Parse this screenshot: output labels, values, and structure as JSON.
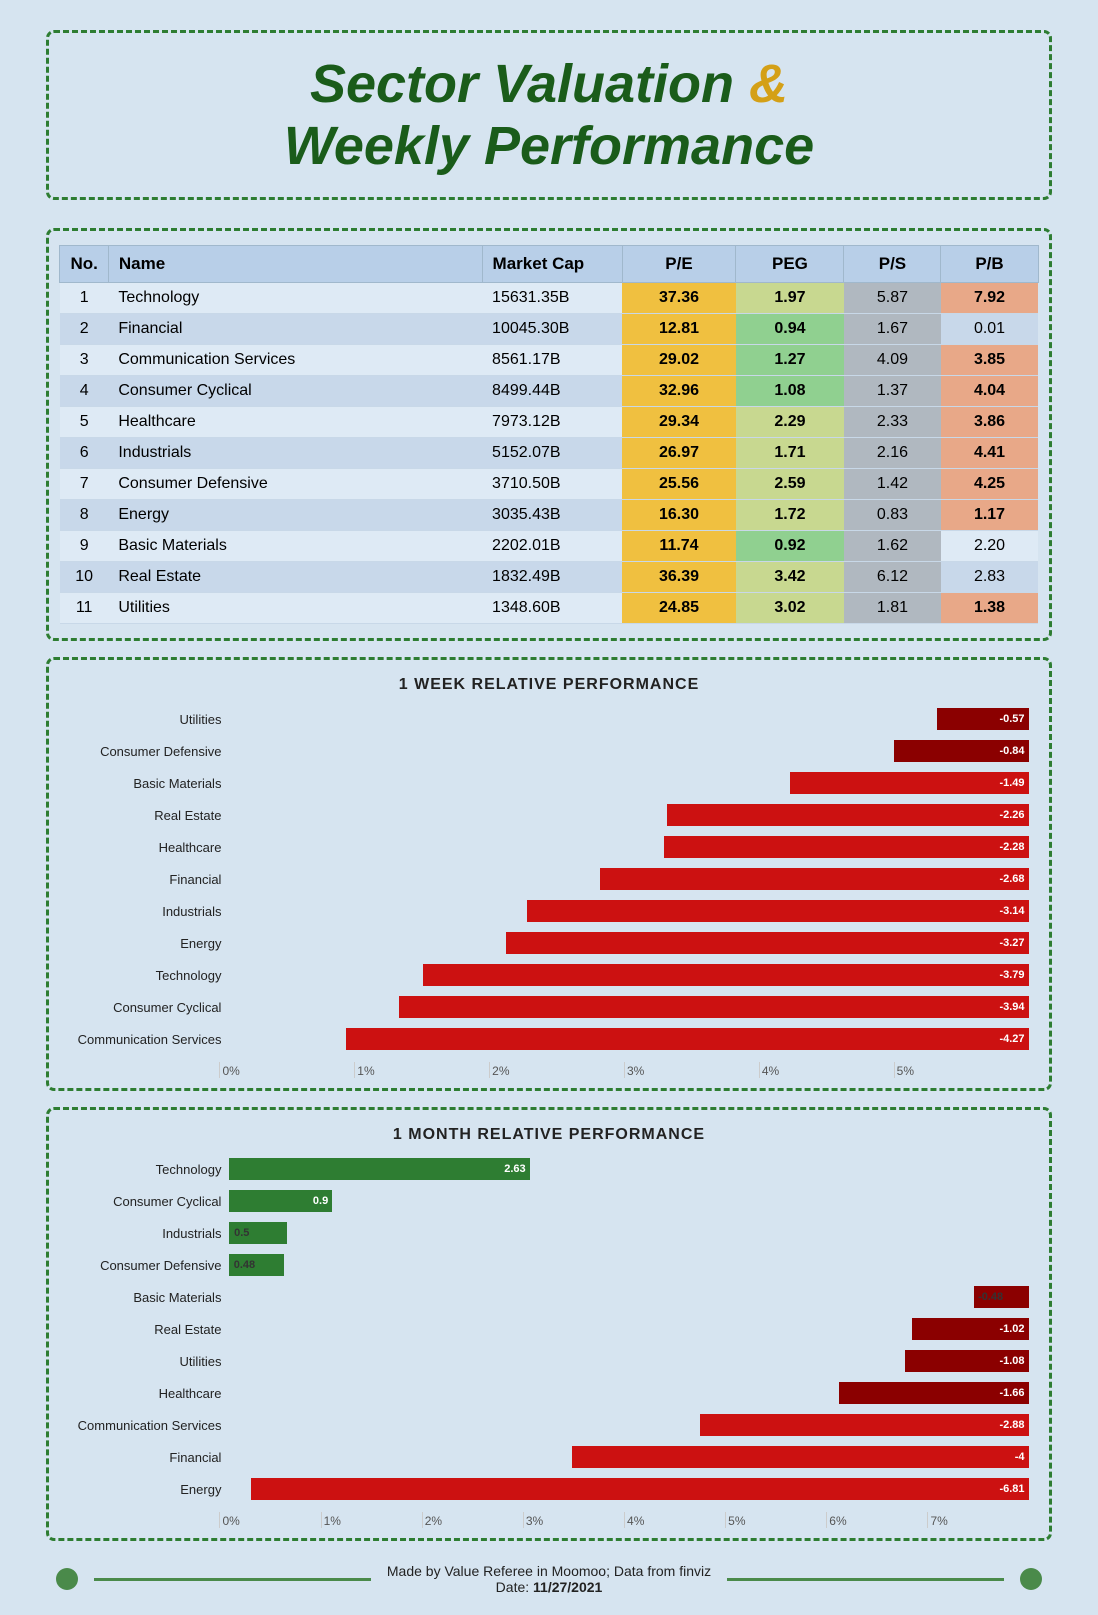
{
  "title": {
    "line1": "Sector Valuation",
    "amp": "&",
    "line2": "Weekly Performance"
  },
  "table": {
    "headers": [
      "No.",
      "Name",
      "Market Cap",
      "P/E",
      "PEG",
      "P/S",
      "P/B"
    ],
    "rows": [
      {
        "no": 1,
        "name": "Technology",
        "mcap": "15631.35B",
        "pe": "37.36",
        "peg": "1.97",
        "ps": "5.87",
        "pb": "7.92",
        "pe_color": "yellow",
        "peg_color": "yellow-green",
        "pb_color": "salmon"
      },
      {
        "no": 2,
        "name": "Financial",
        "mcap": "10045.30B",
        "pe": "12.81",
        "peg": "0.94",
        "ps": "1.67",
        "pb": "0.01",
        "pe_color": "yellow",
        "peg_color": "green",
        "pb_color": "none"
      },
      {
        "no": 3,
        "name": "Communication Services",
        "mcap": "8561.17B",
        "pe": "29.02",
        "peg": "1.27",
        "ps": "4.09",
        "pb": "3.85",
        "pe_color": "yellow",
        "peg_color": "green",
        "pb_color": "salmon"
      },
      {
        "no": 4,
        "name": "Consumer Cyclical",
        "mcap": "8499.44B",
        "pe": "32.96",
        "peg": "1.08",
        "ps": "1.37",
        "pb": "4.04",
        "pe_color": "yellow",
        "peg_color": "green",
        "pb_color": "salmon"
      },
      {
        "no": 5,
        "name": "Healthcare",
        "mcap": "7973.12B",
        "pe": "29.34",
        "peg": "2.29",
        "ps": "2.33",
        "pb": "3.86",
        "pe_color": "yellow",
        "peg_color": "yellow-green",
        "pb_color": "salmon"
      },
      {
        "no": 6,
        "name": "Industrials",
        "mcap": "5152.07B",
        "pe": "26.97",
        "peg": "1.71",
        "ps": "2.16",
        "pb": "4.41",
        "pe_color": "yellow",
        "peg_color": "yellow-green",
        "pb_color": "salmon"
      },
      {
        "no": 7,
        "name": "Consumer Defensive",
        "mcap": "3710.50B",
        "pe": "25.56",
        "peg": "2.59",
        "ps": "1.42",
        "pb": "4.25",
        "pe_color": "yellow",
        "peg_color": "yellow-green",
        "pb_color": "salmon"
      },
      {
        "no": 8,
        "name": "Energy",
        "mcap": "3035.43B",
        "pe": "16.30",
        "peg": "1.72",
        "ps": "0.83",
        "pb": "1.17",
        "pe_color": "yellow",
        "peg_color": "yellow-green",
        "pb_color": "light-salmon"
      },
      {
        "no": 9,
        "name": "Basic Materials",
        "mcap": "2202.01B",
        "pe": "11.74",
        "peg": "0.92",
        "ps": "1.62",
        "pb": "2.20",
        "pe_color": "yellow",
        "peg_color": "green",
        "pb_color": "none"
      },
      {
        "no": 10,
        "name": "Real Estate",
        "mcap": "1832.49B",
        "pe": "36.39",
        "peg": "3.42",
        "ps": "6.12",
        "pb": "2.83",
        "pe_color": "yellow",
        "peg_color": "yellow-green",
        "pb_color": "none"
      },
      {
        "no": 11,
        "name": "Utilities",
        "mcap": "1348.60B",
        "pe": "24.85",
        "peg": "3.02",
        "ps": "1.81",
        "pb": "1.38",
        "pe_color": "yellow",
        "peg_color": "yellow-green",
        "pb_color": "light-salmon"
      }
    ]
  },
  "chart1": {
    "title": "1 WEEK RELATIVE PERFORMANCE",
    "max_pct": 5,
    "ticks": [
      "0%",
      "1%",
      "2%",
      "3%",
      "4%",
      "5%"
    ],
    "bars": [
      {
        "label": "Utilities",
        "value": -0.57,
        "color": "dark-red"
      },
      {
        "label": "Consumer Defensive",
        "value": -0.84,
        "color": "dark-red"
      },
      {
        "label": "Basic Materials",
        "value": -1.49,
        "color": "red"
      },
      {
        "label": "Real Estate",
        "value": -2.26,
        "color": "red"
      },
      {
        "label": "Healthcare",
        "value": -2.28,
        "color": "red"
      },
      {
        "label": "Financial",
        "value": -2.68,
        "color": "red"
      },
      {
        "label": "Industrials",
        "value": -3.14,
        "color": "red"
      },
      {
        "label": "Energy",
        "value": -3.27,
        "color": "red"
      },
      {
        "label": "Technology",
        "value": -3.79,
        "color": "red"
      },
      {
        "label": "Consumer Cyclical",
        "value": -3.94,
        "color": "red"
      },
      {
        "label": "Communication Services",
        "value": -4.27,
        "color": "red"
      }
    ]
  },
  "chart2": {
    "title": "1 MONTH RELATIVE PERFORMANCE",
    "max_pct": 7,
    "ticks": [
      "0%",
      "1%",
      "2%",
      "3%",
      "4%",
      "5%",
      "6%",
      "7%"
    ],
    "bars": [
      {
        "label": "Technology",
        "value": 2.63,
        "color": "green"
      },
      {
        "label": "Consumer Cyclical",
        "value": 0.9,
        "color": "green"
      },
      {
        "label": "Industrials",
        "value": 0.5,
        "color": "green"
      },
      {
        "label": "Consumer Defensive",
        "value": 0.48,
        "color": "green"
      },
      {
        "label": "Basic Materials",
        "value": -0.48,
        "color": "dark-red"
      },
      {
        "label": "Real Estate",
        "value": -1.02,
        "color": "dark-red"
      },
      {
        "label": "Utilities",
        "value": -1.08,
        "color": "dark-red"
      },
      {
        "label": "Healthcare",
        "value": -1.66,
        "color": "dark-red"
      },
      {
        "label": "Communication Services",
        "value": -2.88,
        "color": "red"
      },
      {
        "label": "Financial",
        "value": -4,
        "color": "red"
      },
      {
        "label": "Energy",
        "value": -6.81,
        "color": "red"
      }
    ]
  },
  "footer": {
    "line1": "Made by Value Referee in Moomoo; Data from finviz",
    "line2": "Date: 11/27/2021"
  }
}
